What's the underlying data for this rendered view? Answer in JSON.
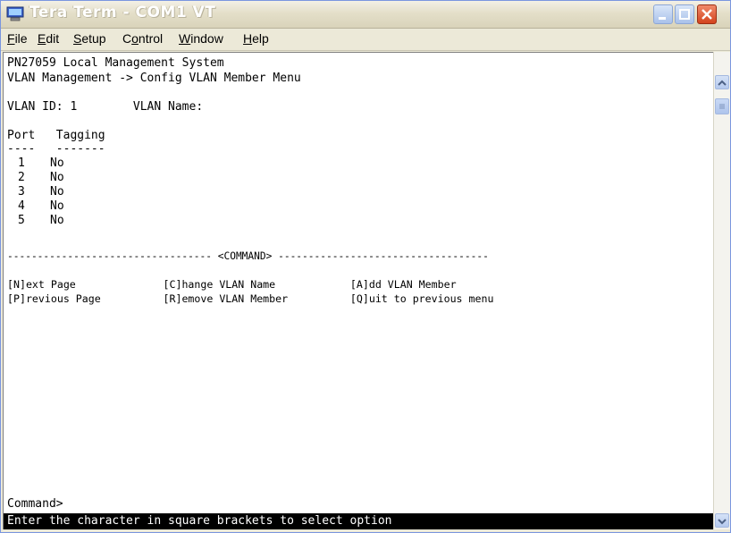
{
  "window": {
    "title": "Tera Term - COM1 VT",
    "colors": {
      "titlebar": "#e4dfc9",
      "close": "#d3431d",
      "terminal_bg": "#ffffff",
      "status_bg": "#000000"
    }
  },
  "menu": [
    {
      "label": "File",
      "accel": "F",
      "rest": "ile"
    },
    {
      "label": "Edit",
      "accel": "E",
      "rest": "dit"
    },
    {
      "label": "Setup",
      "accel": "S",
      "rest": "etup"
    },
    {
      "label": "Control",
      "pre": "C",
      "accel": "o",
      "rest": "ntrol"
    },
    {
      "label": "Window",
      "accel": "W",
      "rest": "indow"
    },
    {
      "label": "Help",
      "accel": "H",
      "rest": "elp"
    }
  ],
  "terminal": {
    "system_title": "PN27059 Local Management System",
    "breadcrumb": "VLAN Management -> Config VLAN Member Menu",
    "vlan_id_line": "VLAN ID: 1        VLAN Name:",
    "header_line": "Port   Tagging",
    "underline_line": "----   -------",
    "ports": [
      {
        "port": "1",
        "tagging": "No"
      },
      {
        "port": "2",
        "tagging": "No"
      },
      {
        "port": "3",
        "tagging": "No"
      },
      {
        "port": "4",
        "tagging": "No"
      },
      {
        "port": "5",
        "tagging": "No"
      }
    ],
    "command_divider": "---------------------------------- <COMMAND> -----------------------------------",
    "commands_row1": "[N]ext Page              [C]hange VLAN Name            [A]dd VLAN Member",
    "commands_row2": "[P]revious Page          [R]emove VLAN Member          [Q]uit to previous menu",
    "prompt": "Command>",
    "status": "Enter the character in square brackets to select option"
  },
  "icons": {
    "app": "tera-term-icon",
    "minimize": "minimize-icon",
    "maximize": "maximize-icon",
    "close": "close-icon"
  }
}
